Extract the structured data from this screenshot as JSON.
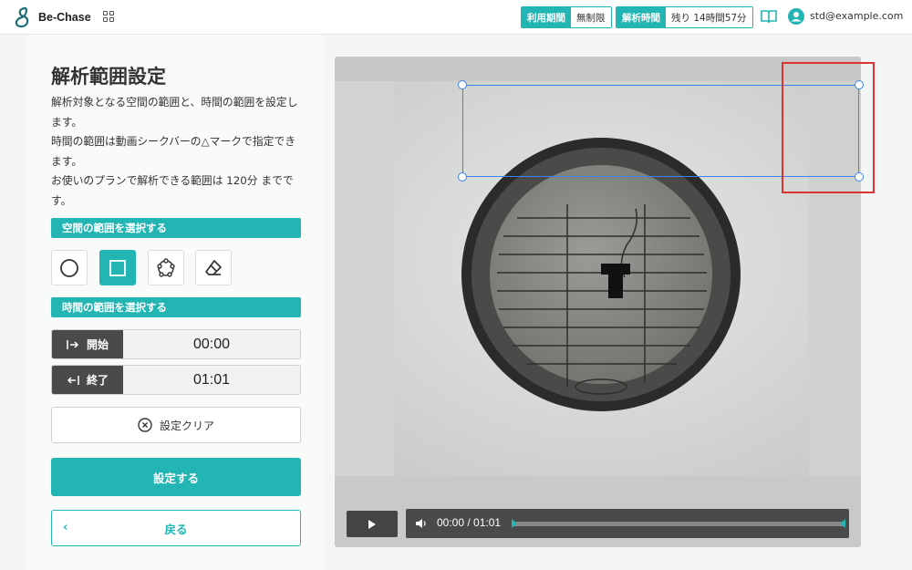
{
  "app": {
    "name": "Be-Chase"
  },
  "header": {
    "period_label": "利用期間",
    "period_value": "無制限",
    "time_label": "解析時間",
    "time_value": "残り 14時間57分",
    "user_email": "std@example.com"
  },
  "panel": {
    "title": "解析範囲設定",
    "description": [
      "解析対象となる空間の範囲と、時間の範囲を設定します。",
      "時間の範囲は動画シークバーの△マークで指定できます。",
      "お使いのプランで解析できる範囲は 120分 までです。"
    ],
    "space_section": "空間の範囲を選択する",
    "time_section": "時間の範囲を選択する",
    "start_label": "開始",
    "start_value": "00:00",
    "end_label": "終了",
    "end_value": "01:01",
    "clear_label": "設定クリア",
    "submit_label": "設定する",
    "back_label": "戻る"
  },
  "player": {
    "time_display": "00:00 / 01:01"
  },
  "colors": {
    "accent": "#22b5b3",
    "selection": "#3b82f6",
    "highlight": "#e03131"
  },
  "icons": [
    "grid-icon",
    "book-icon",
    "user-icon",
    "circle-icon",
    "rectangle-icon",
    "polygon-icon",
    "eraser-icon",
    "arrow-in-icon",
    "arrow-out-icon",
    "close-circle-icon",
    "chevron-left-icon",
    "play-icon",
    "volume-icon"
  ]
}
